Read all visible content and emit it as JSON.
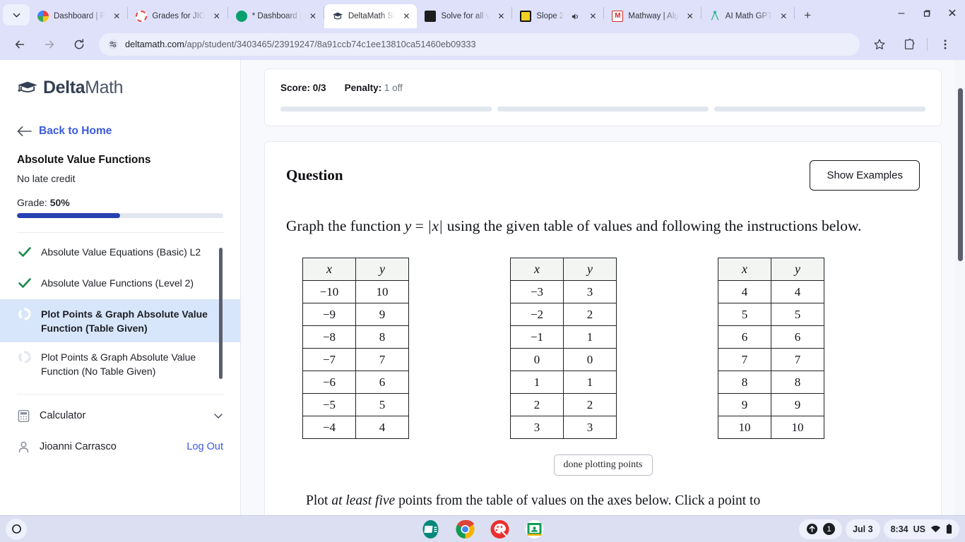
{
  "browser": {
    "tab_list_icon": "chevron-down-icon",
    "tabs": [
      {
        "title": "Dashboard | P",
        "favicon": "pinwheel-icon",
        "active": false,
        "close_label": "✕"
      },
      {
        "title": "Grades for JIO",
        "favicon": "red-circle-icon",
        "active": false,
        "close_label": "✕"
      },
      {
        "title": "* Dashboard |",
        "favicon": "green-shield-icon",
        "active": false,
        "close_label": "✕"
      },
      {
        "title": "DeltaMath St",
        "favicon": "graduation-cap-icon",
        "active": true,
        "close_label": "✕"
      },
      {
        "title": "Solve for all v",
        "favicon": "dark-square-icon",
        "active": false,
        "close_label": "✕"
      },
      {
        "title": "Slope 2",
        "favicon": "yellow-square-icon",
        "active": false,
        "close_label": "✕",
        "audio": true
      },
      {
        "title": "Mathway | Alg",
        "favicon": "mathway-m-icon",
        "active": false,
        "close_label": "✕"
      },
      {
        "title": "AI Math GPT",
        "favicon": "compass-icon",
        "active": false,
        "close_label": "✕"
      }
    ],
    "new_tab_label": "+",
    "window_controls": {
      "minimize": "–",
      "maximize": "❐",
      "close": "✕"
    },
    "toolbar": {
      "back_icon": "arrow-left-icon",
      "forward_icon": "arrow-right-icon",
      "reload_icon": "reload-icon",
      "site_info_icon": "tune-icon",
      "bookmark_icon": "star-icon",
      "extensions_icon": "puzzle-piece-icon",
      "menu_icon": "three-dot-menu-icon",
      "url_host": "deltamath.com",
      "url_path": "/app/student/3403465/23919247/8a91ccb74c1ee13810ca51460eb09333"
    }
  },
  "sidebar": {
    "logo_bold": "Delta",
    "logo_light": "Math",
    "logo_icon": "graduation-cap-icon",
    "back_home": {
      "label": "Back to Home",
      "icon": "arrow-left-icon"
    },
    "assignment_title": "Absolute Value Functions",
    "late_credit": "No late credit",
    "grade_label": "Grade:",
    "grade_value": "50%",
    "grade_percent": 50,
    "grade_bar_color": "#2541b2",
    "problems": [
      {
        "label": "Absolute Value Equations (Basic) L2",
        "status": "complete",
        "icon": "green-check-icon",
        "current": false
      },
      {
        "label": "Absolute Value Functions (Level 2)",
        "status": "complete",
        "icon": "green-check-icon",
        "current": false
      },
      {
        "label": "Plot Points & Graph Absolute Value Function (Table Given)",
        "status": "in-progress",
        "icon": "progress-ring-icon",
        "current": true
      },
      {
        "label": "Plot Points & Graph Absolute Value Function (No Table Given)",
        "status": "not-started",
        "icon": "progress-ring-icon",
        "current": false
      }
    ],
    "calculator": {
      "label": "Calculator",
      "icon": "calculator-icon",
      "chevron": "chevron-down-icon"
    },
    "user": {
      "name": "Jioanni Carrasco",
      "icon": "person-icon",
      "logout_label": "Log Out"
    }
  },
  "status": {
    "score_label": "Score:",
    "score_value": "0/3",
    "penalty_label": "Penalty:",
    "penalty_value": "1 off",
    "segments": [
      0,
      0,
      0
    ]
  },
  "question": {
    "heading": "Question",
    "show_examples_label": "Show Examples",
    "prompt_prefix": "Graph the function",
    "prompt_fn_y": "y",
    "prompt_eq": "=",
    "prompt_fn_x": "x",
    "prompt_suffix": "using the given table of values and following the instructions below.",
    "done_plotting_label": "done plotting points",
    "instruction_pre": "Plot",
    "instruction_em": "at least five",
    "instruction_post": "points from the table of values on the axes below. Click a point to"
  },
  "tables": [
    {
      "headers": [
        "x",
        "y"
      ],
      "rows": [
        [
          "−10",
          "10"
        ],
        [
          "−9",
          "9"
        ],
        [
          "−8",
          "8"
        ],
        [
          "−7",
          "7"
        ],
        [
          "−6",
          "6"
        ],
        [
          "−5",
          "5"
        ],
        [
          "−4",
          "4"
        ]
      ]
    },
    {
      "headers": [
        "x",
        "y"
      ],
      "rows": [
        [
          "−3",
          "3"
        ],
        [
          "−2",
          "2"
        ],
        [
          "−1",
          "1"
        ],
        [
          "0",
          "0"
        ],
        [
          "1",
          "1"
        ],
        [
          "2",
          "2"
        ],
        [
          "3",
          "3"
        ]
      ]
    },
    {
      "headers": [
        "x",
        "y"
      ],
      "rows": [
        [
          "4",
          "4"
        ],
        [
          "5",
          "5"
        ],
        [
          "6",
          "6"
        ],
        [
          "7",
          "7"
        ],
        [
          "8",
          "8"
        ],
        [
          "9",
          "9"
        ],
        [
          "10",
          "10"
        ]
      ]
    }
  ],
  "shelf": {
    "launcher_icon": "launcher-circle-icon",
    "apps": [
      {
        "name": "google-news-app",
        "icon": "news-icon"
      },
      {
        "name": "google-chrome-app",
        "icon": "chrome-icon",
        "active": true
      },
      {
        "name": "paint-app",
        "icon": "palette-icon"
      },
      {
        "name": "google-classroom-app",
        "icon": "classroom-icon"
      }
    ],
    "tray": {
      "notification_count": "1",
      "upload_icon": "up-arrow-icon",
      "date": "Jul 3",
      "time": "8:34",
      "locale": "US",
      "wifi_icon": "wifi-icon",
      "battery_icon": "battery-icon"
    }
  }
}
